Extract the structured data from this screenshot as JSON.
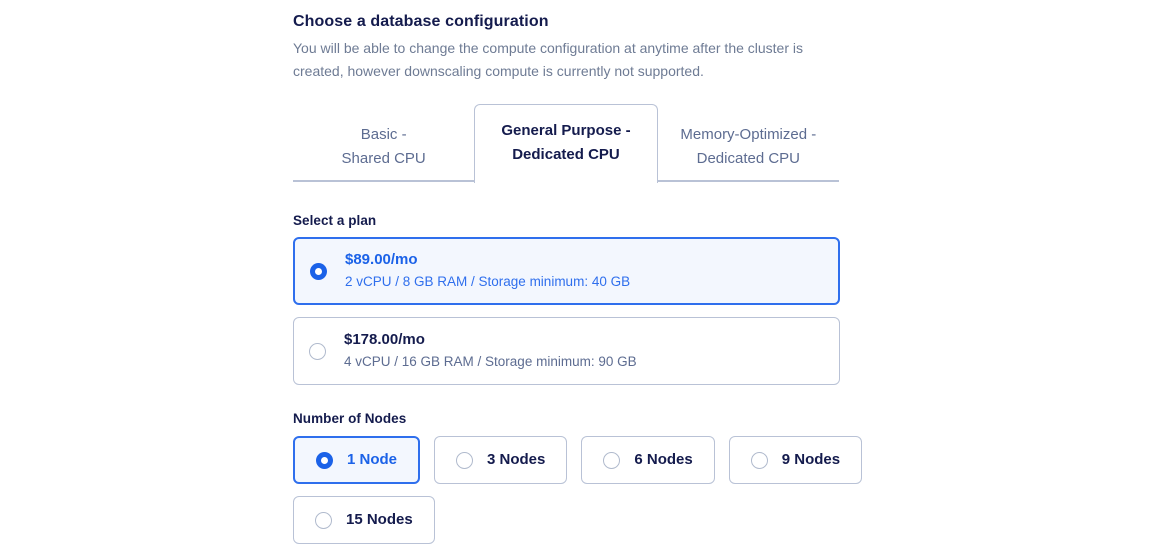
{
  "header": {
    "title": "Choose a database configuration",
    "description": "You will be able to change the compute configuration at anytime after the cluster is created, however downscaling compute is currently not supported."
  },
  "tabs": [
    {
      "line1": "Basic -",
      "line2": "Shared CPU",
      "active": false
    },
    {
      "line1": "General Purpose -",
      "line2": "Dedicated CPU",
      "active": true
    },
    {
      "line1": "Memory-Optimized -",
      "line2": "Dedicated CPU",
      "active": false
    }
  ],
  "plan_section": {
    "label": "Select a plan",
    "plans": [
      {
        "price": "$89.00/mo",
        "specs": "2 vCPU / 8 GB RAM / Storage minimum: 40 GB",
        "selected": true
      },
      {
        "price": "$178.00/mo",
        "specs": "4 vCPU / 16 GB RAM / Storage minimum: 90 GB",
        "selected": false
      }
    ]
  },
  "nodes_section": {
    "label": "Number of Nodes",
    "row1": [
      {
        "label": "1 Node",
        "selected": true
      },
      {
        "label": "3 Nodes",
        "selected": false
      },
      {
        "label": "6 Nodes",
        "selected": false
      },
      {
        "label": "9 Nodes",
        "selected": false
      }
    ],
    "row2": [
      {
        "label": "15 Nodes",
        "selected": false
      }
    ]
  },
  "colors": {
    "accent_blue": "#1b62e8",
    "accent_border": "#2f6fed",
    "selected_bg": "#f3f7fe",
    "navy_text": "#141b4d",
    "muted_text": "#6e7b94",
    "border_gray": "#b9c2d6"
  },
  "icons": {
    "radio_selected": "radio-selected-icon",
    "radio_unselected": "radio-unselected-icon"
  }
}
